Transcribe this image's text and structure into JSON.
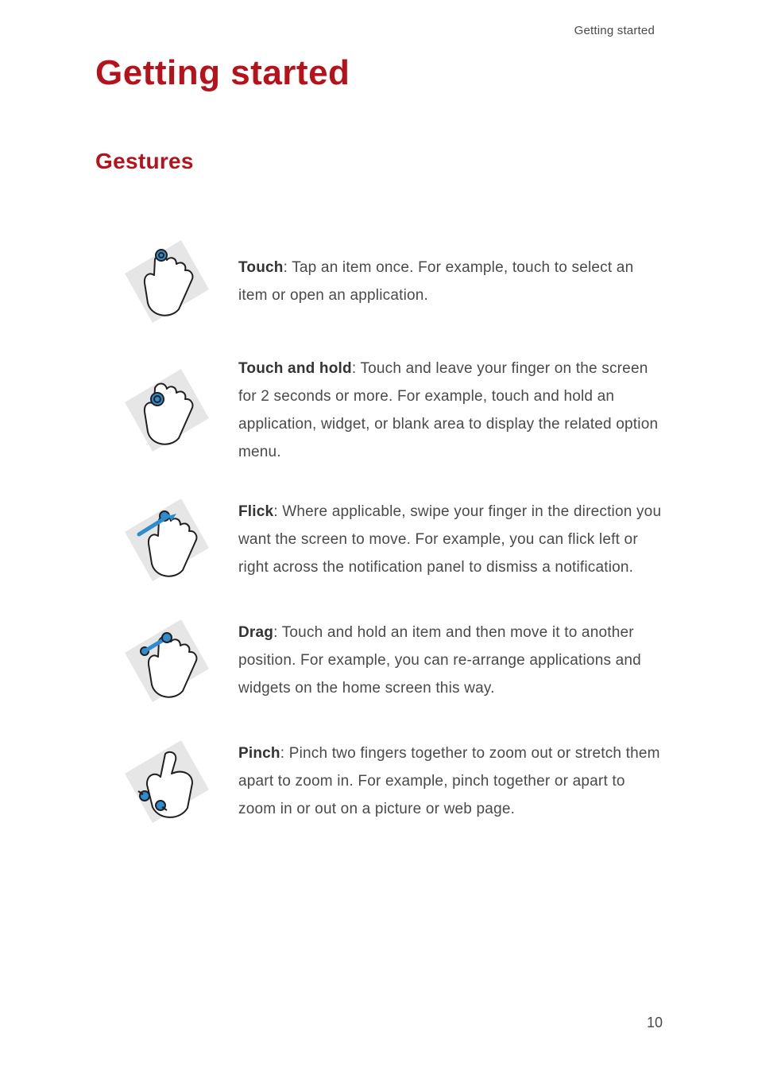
{
  "running_head": "Getting started",
  "title": "Getting started",
  "section": "Gestures",
  "pageNumber": "10",
  "gestures": [
    {
      "name": "Touch",
      "body": ": Tap an item once. For example, touch to select an item or open an application."
    },
    {
      "name": "Touch and hold",
      "body": ": Touch and leave your finger on the screen for 2 seconds or more. For example, touch and hold an application, widget, or blank area to display the related option menu."
    },
    {
      "name": "Flick",
      "body": ": Where applicable, swipe your finger in the direction you want the screen to move. For example, you can flick left or right across the notification panel to dismiss a notification."
    },
    {
      "name": "Drag",
      "body": ": Touch and hold an item and then move it to another position. For example, you can re-arrange applications and widgets on the home screen this way."
    },
    {
      "name": "Pinch",
      "body": ": Pinch two fingers together to zoom out or stretch them apart to zoom in. For example, pinch together or apart to zoom in or out on a picture or web page."
    }
  ]
}
